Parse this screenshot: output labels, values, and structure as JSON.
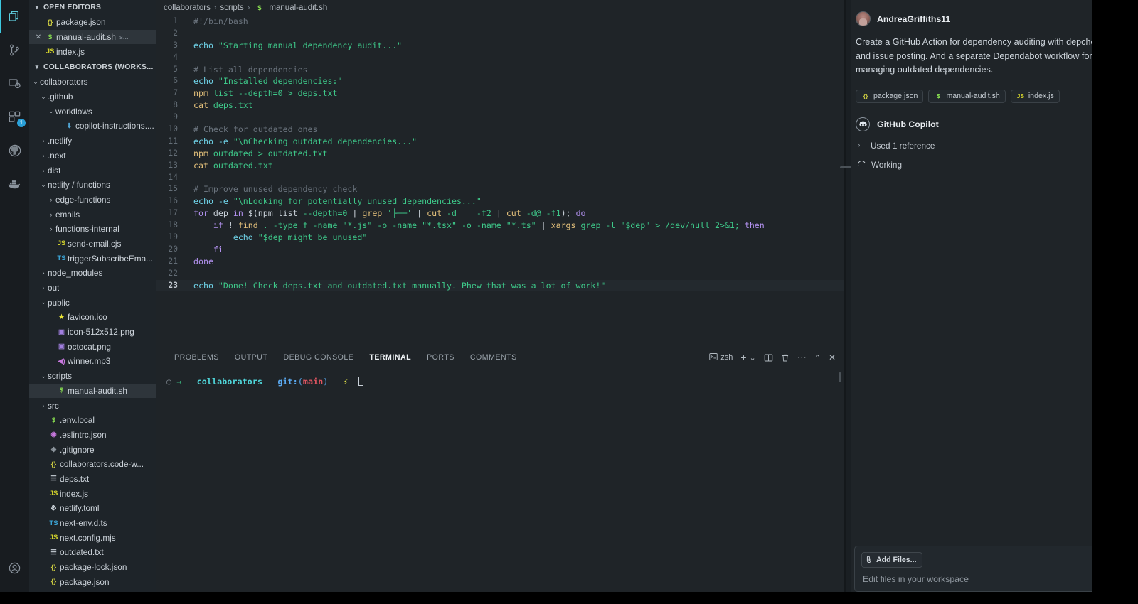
{
  "activitybar": {
    "items": [
      {
        "name": "explorer",
        "icon": "files-icon",
        "active": true,
        "badge": ""
      },
      {
        "name": "source-control",
        "icon": "source-control-icon",
        "active": false,
        "badge": ""
      },
      {
        "name": "remote-explorer",
        "icon": "remote-explorer-icon",
        "active": false,
        "badge": ""
      },
      {
        "name": "extensions",
        "icon": "extensions-icon",
        "active": false,
        "badge": "1"
      },
      {
        "name": "github",
        "icon": "github-icon",
        "active": false,
        "badge": ""
      },
      {
        "name": "docker",
        "icon": "docker-icon",
        "active": false,
        "badge": ""
      }
    ],
    "account_icon": "account-icon"
  },
  "sidebar": {
    "open_editors": {
      "title": "OPEN EDITORS",
      "items": [
        {
          "label": "package.json",
          "icon": "{}",
          "icon_class": "c-json",
          "selected": false,
          "closable": false,
          "suffix": ""
        },
        {
          "label": "manual-audit.sh",
          "icon": "$",
          "icon_class": "c-sh",
          "selected": true,
          "closable": true,
          "suffix": "s..."
        },
        {
          "label": "index.js",
          "icon": "JS",
          "icon_class": "c-js",
          "selected": false,
          "closable": false,
          "suffix": ""
        }
      ]
    },
    "explorer": {
      "title": "COLLABORATORS (WORKS...",
      "tree": [
        {
          "label": "collaborators",
          "indent": 1,
          "kind": "folder-open",
          "icon": "",
          "icon_class": ""
        },
        {
          "label": ".github",
          "indent": 2,
          "kind": "folder-open",
          "icon": "",
          "icon_class": ""
        },
        {
          "label": "workflows",
          "indent": 3,
          "kind": "folder-open",
          "icon": "",
          "icon_class": ""
        },
        {
          "label": "copilot-instructions....",
          "indent": 4,
          "kind": "file",
          "icon": "⬇",
          "icon_class": "c-gh"
        },
        {
          "label": ".netlify",
          "indent": 2,
          "kind": "folder-closed",
          "icon": "",
          "icon_class": ""
        },
        {
          "label": ".next",
          "indent": 2,
          "kind": "folder-closed",
          "icon": "",
          "icon_class": ""
        },
        {
          "label": "dist",
          "indent": 2,
          "kind": "folder-closed",
          "icon": "",
          "icon_class": ""
        },
        {
          "label": "netlify / functions",
          "indent": 2,
          "kind": "folder-open",
          "icon": "",
          "icon_class": ""
        },
        {
          "label": "edge-functions",
          "indent": 3,
          "kind": "folder-closed",
          "icon": "",
          "icon_class": ""
        },
        {
          "label": "emails",
          "indent": 3,
          "kind": "folder-closed",
          "icon": "",
          "icon_class": ""
        },
        {
          "label": "functions-internal",
          "indent": 3,
          "kind": "folder-closed",
          "icon": "",
          "icon_class": ""
        },
        {
          "label": "send-email.cjs",
          "indent": 3,
          "kind": "file",
          "icon": "JS",
          "icon_class": "c-js"
        },
        {
          "label": "triggerSubscribeEma...",
          "indent": 3,
          "kind": "file",
          "icon": "TS",
          "icon_class": "c-ts"
        },
        {
          "label": "node_modules",
          "indent": 2,
          "kind": "folder-closed",
          "icon": "",
          "icon_class": ""
        },
        {
          "label": "out",
          "indent": 2,
          "kind": "folder-closed",
          "icon": "",
          "icon_class": ""
        },
        {
          "label": "public",
          "indent": 2,
          "kind": "folder-open",
          "icon": "",
          "icon_class": ""
        },
        {
          "label": "favicon.ico",
          "indent": 3,
          "kind": "file",
          "icon": "★",
          "icon_class": "c-star"
        },
        {
          "label": "icon-512x512.png",
          "indent": 3,
          "kind": "file",
          "icon": "▣",
          "icon_class": "c-img"
        },
        {
          "label": "octocat.png",
          "indent": 3,
          "kind": "file",
          "icon": "▣",
          "icon_class": "c-img"
        },
        {
          "label": "winner.mp3",
          "indent": 3,
          "kind": "file",
          "icon": "◀)",
          "icon_class": "c-audio"
        },
        {
          "label": "scripts",
          "indent": 2,
          "kind": "folder-open",
          "icon": "",
          "icon_class": ""
        },
        {
          "label": "manual-audit.sh",
          "indent": 3,
          "kind": "file",
          "icon": "$",
          "icon_class": "c-sh",
          "selected": true
        },
        {
          "label": "src",
          "indent": 2,
          "kind": "folder-closed",
          "icon": "",
          "icon_class": ""
        },
        {
          "label": ".env.local",
          "indent": 2,
          "kind": "file",
          "icon": "$",
          "icon_class": "c-sh"
        },
        {
          "label": ".eslintrc.json",
          "indent": 2,
          "kind": "file",
          "icon": "◉",
          "icon_class": "c-purple"
        },
        {
          "label": ".gitignore",
          "indent": 2,
          "kind": "file",
          "icon": "◈",
          "icon_class": "c-gray"
        },
        {
          "label": "collaborators.code-w...",
          "indent": 2,
          "kind": "file",
          "icon": "{}",
          "icon_class": "c-json"
        },
        {
          "label": "deps.txt",
          "indent": 2,
          "kind": "file",
          "icon": "☰",
          "icon_class": "c-txt"
        },
        {
          "label": "index.js",
          "indent": 2,
          "kind": "file",
          "icon": "JS",
          "icon_class": "c-js"
        },
        {
          "label": "netlify.toml",
          "indent": 2,
          "kind": "file",
          "icon": "⚙",
          "icon_class": "c-gear"
        },
        {
          "label": "next-env.d.ts",
          "indent": 2,
          "kind": "file",
          "icon": "TS",
          "icon_class": "c-ts"
        },
        {
          "label": "next.config.mjs",
          "indent": 2,
          "kind": "file",
          "icon": "JS",
          "icon_class": "c-js"
        },
        {
          "label": "outdated.txt",
          "indent": 2,
          "kind": "file",
          "icon": "☰",
          "icon_class": "c-txt"
        },
        {
          "label": "package-lock.json",
          "indent": 2,
          "kind": "file",
          "icon": "{}",
          "icon_class": "c-json"
        },
        {
          "label": "package.json",
          "indent": 2,
          "kind": "file",
          "icon": "{}",
          "icon_class": "c-json"
        }
      ]
    }
  },
  "editor": {
    "breadcrumb": [
      "collaborators",
      "scripts",
      "manual-audit.sh"
    ],
    "breadcrumb_file_icon": "$",
    "active_line": 23,
    "lines": [
      {
        "n": 1,
        "tokens": [
          [
            "k-cmt",
            "#!/bin/bash"
          ]
        ]
      },
      {
        "n": 2,
        "tokens": []
      },
      {
        "n": 3,
        "tokens": [
          [
            "k-cmd",
            "echo "
          ],
          [
            "k-str",
            "\"Starting manual dependency audit...\""
          ]
        ]
      },
      {
        "n": 4,
        "tokens": []
      },
      {
        "n": 5,
        "tokens": [
          [
            "k-cmt",
            "# List all dependencies"
          ]
        ]
      },
      {
        "n": 6,
        "tokens": [
          [
            "k-cmd",
            "echo "
          ],
          [
            "k-str",
            "\"Installed dependencies:\""
          ]
        ]
      },
      {
        "n": 7,
        "tokens": [
          [
            "k-var",
            "npm "
          ],
          [
            "k-str",
            "list --depth=0 > deps.txt"
          ]
        ]
      },
      {
        "n": 8,
        "tokens": [
          [
            "k-var",
            "cat "
          ],
          [
            "k-str",
            "deps.txt"
          ]
        ]
      },
      {
        "n": 9,
        "tokens": []
      },
      {
        "n": 10,
        "tokens": [
          [
            "k-cmt",
            "# Check for outdated ones"
          ]
        ]
      },
      {
        "n": 11,
        "tokens": [
          [
            "k-cmd",
            "echo -e "
          ],
          [
            "k-str",
            "\"\\nChecking outdated dependencies...\""
          ]
        ]
      },
      {
        "n": 12,
        "tokens": [
          [
            "k-var",
            "npm "
          ],
          [
            "k-str",
            "outdated > outdated.txt"
          ]
        ]
      },
      {
        "n": 13,
        "tokens": [
          [
            "k-var",
            "cat "
          ],
          [
            "k-str",
            "outdated.txt"
          ]
        ]
      },
      {
        "n": 14,
        "tokens": []
      },
      {
        "n": 15,
        "tokens": [
          [
            "k-cmt",
            "# Improve unused dependency check"
          ]
        ]
      },
      {
        "n": 16,
        "tokens": [
          [
            "k-cmd",
            "echo -e "
          ],
          [
            "k-str",
            "\"\\nLooking for potentially unused dependencies...\""
          ]
        ]
      },
      {
        "n": 17,
        "tokens": [
          [
            "k-kw",
            "for "
          ],
          [
            "k-pl",
            "dep "
          ],
          [
            "k-kw",
            "in "
          ],
          [
            "k-pl",
            "$(npm list "
          ],
          [
            "k-str",
            "--depth=0 "
          ],
          [
            "k-pl",
            "| "
          ],
          [
            "k-var",
            "grep "
          ],
          [
            "k-str",
            "'├──' "
          ],
          [
            "k-pl",
            "| "
          ],
          [
            "k-var",
            "cut "
          ],
          [
            "k-str",
            "-d' ' -f2 "
          ],
          [
            "k-pl",
            "| "
          ],
          [
            "k-var",
            "cut "
          ],
          [
            "k-str",
            "-d@ -f1"
          ],
          [
            "k-pl",
            "); "
          ],
          [
            "k-kw",
            "do"
          ]
        ]
      },
      {
        "n": 18,
        "tokens": [
          [
            "k-pl",
            "    "
          ],
          [
            "k-kw",
            "if "
          ],
          [
            "k-pl",
            "! "
          ],
          [
            "k-var",
            "find "
          ],
          [
            "k-str",
            ". -type f -name \"*.js\" -o -name \"*.tsx\" -o -name \"*.ts\" "
          ],
          [
            "k-pl",
            "| "
          ],
          [
            "k-var",
            "xargs "
          ],
          [
            "k-str",
            "grep -l \"$dep\" > /dev/null 2>&1; "
          ],
          [
            "k-kw",
            "then"
          ]
        ]
      },
      {
        "n": 19,
        "tokens": [
          [
            "k-pl",
            "        "
          ],
          [
            "k-cmd",
            "echo "
          ],
          [
            "k-str",
            "\"$dep might be unused\""
          ]
        ]
      },
      {
        "n": 20,
        "tokens": [
          [
            "k-pl",
            "    "
          ],
          [
            "k-kw",
            "fi"
          ]
        ]
      },
      {
        "n": 21,
        "tokens": [
          [
            "k-kw",
            "done"
          ]
        ]
      },
      {
        "n": 22,
        "tokens": []
      },
      {
        "n": 23,
        "tokens": [
          [
            "k-cmd",
            "echo "
          ],
          [
            "k-str",
            "\"Done! Check deps.txt and outdated.txt manually. Phew that was a lot of work!\""
          ]
        ]
      }
    ]
  },
  "panel": {
    "tabs": [
      {
        "label": "PROBLEMS",
        "active": false
      },
      {
        "label": "OUTPUT",
        "active": false
      },
      {
        "label": "DEBUG CONSOLE",
        "active": false
      },
      {
        "label": "TERMINAL",
        "active": true
      },
      {
        "label": "PORTS",
        "active": false
      },
      {
        "label": "COMMENTS",
        "active": false
      }
    ],
    "actions": {
      "shell_label": "zsh",
      "new_terminal": "+",
      "dropdown": "⌄",
      "split": "split-terminal-icon",
      "kill": "trash-icon",
      "more": "⋯",
      "maximize": "⌃",
      "close": "✕"
    },
    "terminal": {
      "prompt_dot": "○",
      "prompt_arrow": "→",
      "dir": "collaborators",
      "git_label": "git:",
      "branch": "main",
      "flag": "⚡",
      "command": ""
    }
  },
  "chat": {
    "user": "AndreaGriffiths11",
    "message": "Create a GitHub Action for dependency auditing with depcheck and issue posting. And a separate Dependabot workflow for managing outdated dependencies.",
    "chips": [
      {
        "label": "package.json",
        "icon": "{}",
        "icon_class": "c-json"
      },
      {
        "label": "manual-audit.sh",
        "icon": "$",
        "icon_class": "c-sh"
      },
      {
        "label": "index.js",
        "icon": "JS",
        "icon_class": "c-js"
      }
    ],
    "assistant_name": "GitHub Copilot",
    "used_reference": "Used 1 reference",
    "status": "Working",
    "add_files_label": "Add Files...",
    "input_placeholder": "Edit files in your workspace"
  }
}
